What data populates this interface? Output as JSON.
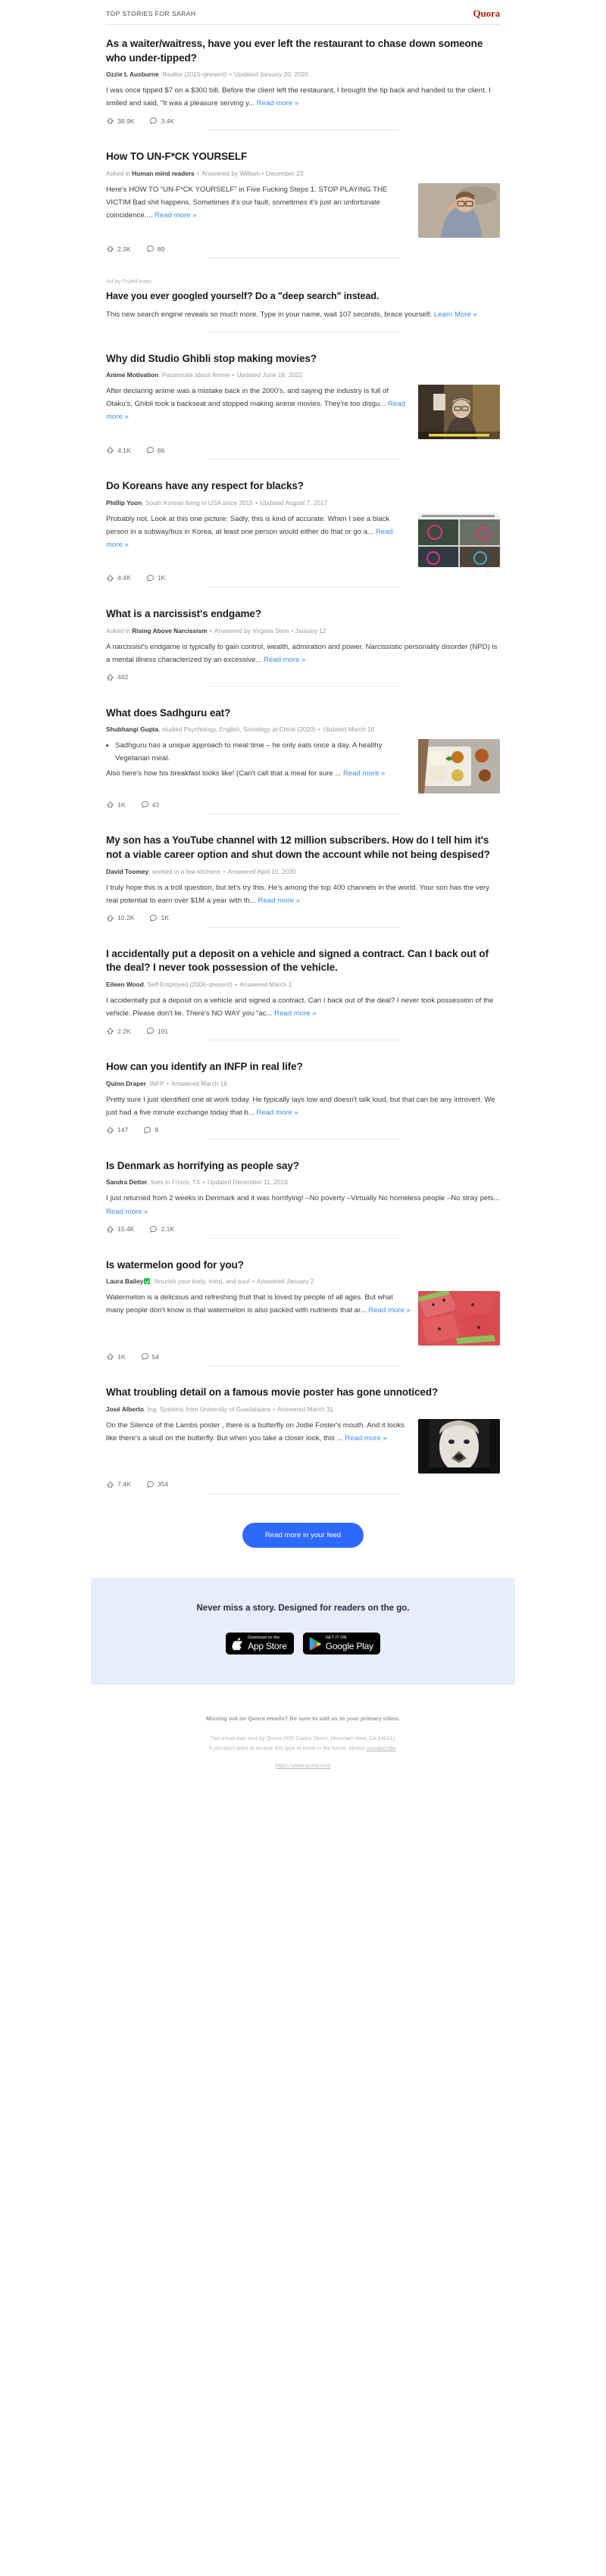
{
  "header": {
    "title": "TOP STORIES FOR SARAH",
    "logo": "Quora"
  },
  "labels": {
    "read_more": "Read more »",
    "learn_more": "Learn More »"
  },
  "stories": [
    {
      "title": "As a waiter/waitress, have you ever left the restaurant to chase down someone who under-tipped?",
      "author": "Ozzie L Ausburne",
      "credential": ", Realtor (2015–present)",
      "meta": "Updated January 20, 2020",
      "body": "I was once tipped $7 on a $300 bill. Before the client left the restaurant, I brought the tip back and handed to the client. I smiled and said, “It was a pleasure serving y...",
      "upvotes": "38.9K",
      "comments": "3.4K",
      "has_image": false
    },
    {
      "title": "How TO UN-F*CK YOURSELF",
      "asked_in_prefix": "Asked in ",
      "author": "Human mind readers",
      "credential": "",
      "meta": "Answered by William • December 23",
      "body": "Here's HOW TO “UN-F*CK YOURSELF\" in Five Fucking Steps 1. STOP PLAYING THE VICTIM Bad shit happens. Sometimes it's our fault, sometimes it's just an unfortunate coincidence....",
      "upvotes": "2.3K",
      "comments": "89",
      "has_image": true,
      "image": "man-with-glasses-thinking"
    },
    {
      "title": "Why did Studio Ghibli stop making movies?",
      "author": "Anime Motivation",
      "credential": ", Passionate about Anime",
      "meta": "Updated June 18, 2022",
      "body": "After declaring anime was a mistake back in the 2000's, and saying the industry is full of Otaku's, Ghibli took a backseat and stopped making anime movies. They're too disgu...",
      "upvotes": "4.1K",
      "comments": "86",
      "has_image": true,
      "image": "hayao-miyazaki-interview"
    },
    {
      "title": "Do Koreans have any respect for blacks?",
      "author": "Phillip Yoon",
      "credential": ", South Korean living in USA since 2015",
      "meta": "Updated August 7, 2017",
      "body": "Probably not. Look at this one picture: Sadly, this is kind of accurate. When I see a black person in a subway/bus in Korea, at least one person would either do that or go a...",
      "upvotes": "4.4K",
      "comments": "1K",
      "has_image": true,
      "image": "subway-photo-collage"
    },
    {
      "title": "What is a narcissist's endgame?",
      "asked_in_prefix": "Asked in ",
      "author": "Rising Above Narcissism",
      "credential": "",
      "meta": "Answered by Virginia Stein • January 12",
      "body": "A narcissist's endgame is typically to gain control, wealth, admiration and power. Narcissistic personality disorder (NPD) is a mental illness characterized by an excessive...",
      "upvotes": "442",
      "comments": null,
      "has_image": false
    },
    {
      "title": "What does Sadhguru eat?",
      "author": "Shubhangi Gupta",
      "credential": ", studied Psychology, English, Sociology at Christ (2020)",
      "meta": "Updated March 16",
      "bullet": "Sadhguru has a unique approach to meal time – he only eats once a day. A healthy Vegetarian meal.",
      "body": "Also here's how his breakfast looks like! (Can't call that a meal for sure ...",
      "upvotes": "1K",
      "comments": "43",
      "has_image": true,
      "image": "indian-thali-meal"
    },
    {
      "title": "My son has a YouTube channel with 12 million subscribers. How do I tell him it's not a viable career option and shut down the account while not being despised?",
      "author": "David Toomey",
      "credential": ", worked in a few kitchens",
      "meta": "Answered April 10, 2020",
      "body": "I truly hope this is a troll question, but let's try this. He's among the top 400 channels in the world. Your son has the very real potential to earn over $1M a year with th...",
      "upvotes": "10.2K",
      "comments": "1K",
      "has_image": false
    },
    {
      "title": "I accidentally put a deposit on a vehicle and signed a contract. Can I back out of the deal? I never took possession of the vehicle.",
      "author": "Eileen Wood",
      "credential": ", Self-Employed (2006–present)",
      "meta": "Answered March 1",
      "body": "I accidentally put a deposit on a vehicle and signed a contract. Can I back out of the deal? I never took possession of the vehicle. Please don't lie. There's NO WAY you \"ac...",
      "upvotes": "2.2K",
      "comments": "191",
      "has_image": false
    },
    {
      "title": "How can you identify an INFP in real life?",
      "author": "Quinn Draper",
      "credential": ", INFP",
      "meta": "Answered March 16",
      "body": "Pretty sure I just identified one at work today. He typically lays low and doesn't talk loud, but that can be any introvert. We just had a five minute exchange today that b...",
      "upvotes": "147",
      "comments": "8",
      "has_image": false
    },
    {
      "title": "Is Denmark as horrifying as people say?",
      "author": "Sandra Detter",
      "credential": ", lives in Frisco, TX",
      "meta": "Updated December 11, 2018",
      "body": "I just returned from 2 weeks in Denmark and it was horrifying! –No poverty –Virtually No homeless people –No stray pets...",
      "upvotes": "15.4K",
      "comments": "2.1K",
      "has_image": false
    },
    {
      "title": "Is watermelon good for you?",
      "author": "Laura Bailey",
      "verified": true,
      "credential": ", Nourish your body, mind, and soul",
      "meta": "Answered January 2",
      "body": "Watermelon is a delicious and refreshing fruit that is loved by people of all ages. But what many people don't know is that watermelon is also packed with nutrients that ar...",
      "upvotes": "1K",
      "comments": "54",
      "has_image": true,
      "image": "sliced-watermelon"
    },
    {
      "title": "What troubling detail on a famous movie poster has gone unnoticed?",
      "author": "José Alberto",
      "credential": ", Ing. Systems from University of Guadalajara",
      "meta": "Answered March 31",
      "body": "On the Silence of the Lambs poster , there is a butterfly on Jodie Foster's mouth. And it looks like there's a skull on the butterfly. But when you take a closer look, this ...",
      "upvotes": "7.4K",
      "comments": "354",
      "has_image": true,
      "image": "silence-of-the-lambs-poster"
    }
  ],
  "ad": {
    "label": "Ad by TruthFinder.",
    "title": "Have you ever googled yourself? Do a \"deep search\" instead.",
    "body": "This new search engine reveals so much more. Type in your name, wait 107 seconds, brace yourself. ",
    "cta": "Learn More »"
  },
  "cta": {
    "label": "Read more in your feed"
  },
  "promo": {
    "title": "Never miss a story. Designed for readers on the go.",
    "app_store": {
      "small": "Download on the",
      "large": "App Store"
    },
    "google_play": {
      "small": "GET IT ON",
      "large": "Google Play"
    }
  },
  "footer": {
    "strong": "Missing out on Quora emails? Be sure to add us to your primary inbox.",
    "line1": "This email was sent by Quora (605 Castro Street, Mountain View, CA 94041).",
    "line2_before": "If you don't want to receive this type of email in the future, please ",
    "unsubscribe": "unsubscribe",
    "line2_after": ".",
    "url": "https://www.quora.com"
  },
  "colors": {
    "brand": "#a82400",
    "link": "#3d8ef0",
    "cta": "#2e69ff",
    "promo_bg": "#e8edfb"
  }
}
